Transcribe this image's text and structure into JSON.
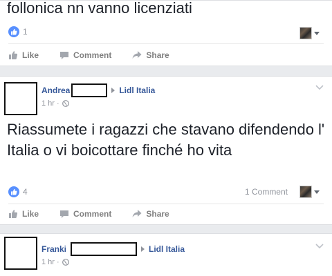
{
  "post1": {
    "text": "follonica nn vanno licenziati",
    "like_count": "1",
    "actions": {
      "like": "Like",
      "comment": "Comment",
      "share": "Share"
    }
  },
  "post2": {
    "author": "Andrea",
    "page": "Lidl Italia",
    "time": "1 hr ·",
    "text": "Riassumete i ragazzi che stavano difendendo l' Italia o vi boicottare finché ho vita",
    "like_count": "4",
    "comment_count": "1 Comment",
    "actions": {
      "like": "Like",
      "comment": "Comment",
      "share": "Share"
    }
  },
  "post3": {
    "author": "Franki",
    "page": "Lidl Italia",
    "time": "1 hr ·"
  },
  "colors": {
    "link": "#365899",
    "muted": "#90949c",
    "like_blue": "#5890ff",
    "background": "#e9ebee"
  },
  "icons": [
    "like-icon",
    "comment-icon",
    "share-icon",
    "globe-icon",
    "chevron-down-icon",
    "caret-down-icon"
  ]
}
